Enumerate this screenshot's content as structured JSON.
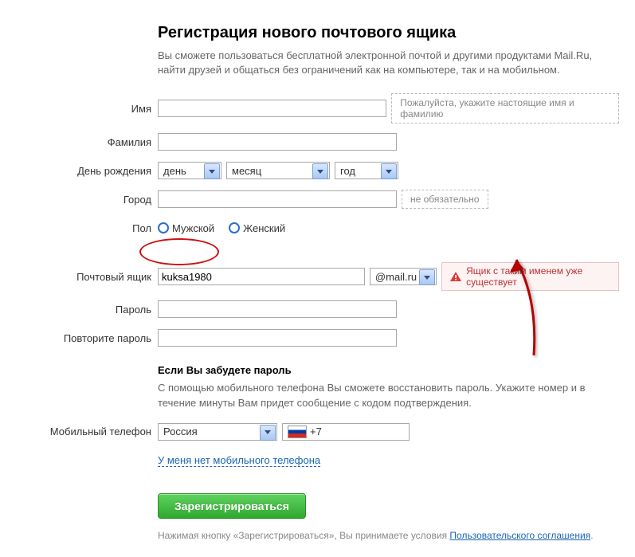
{
  "header": {
    "title": "Регистрация нового почтового ящика",
    "subtitle": "Вы сможете пользоваться бесплатной электронной почтой и другими продуктами Mail.Ru, найти друзей и общаться без ограничений как на компьютере, так и на мобильном."
  },
  "labels": {
    "first_name": "Имя",
    "last_name": "Фамилия",
    "birthday": "День рождения",
    "city": "Город",
    "gender": "Пол",
    "mailbox": "Почтовый ящик",
    "password": "Пароль",
    "password_repeat": "Повторите пароль",
    "mobile": "Мобильный телефон"
  },
  "hints": {
    "name": "Пожалуйста, укажите настоящие имя и фамилию",
    "optional": "не обязательно"
  },
  "birthday": {
    "day": "день",
    "month": "месяц",
    "year": "год"
  },
  "gender": {
    "male": "Мужской",
    "female": "Женский"
  },
  "mailbox": {
    "value": "kuksa1980",
    "domain": "@mail.ru"
  },
  "error": {
    "text": "Ящик с таким именем уже существует"
  },
  "recovery": {
    "heading": "Если Вы забудете пароль",
    "desc": "С помощью мобильного телефона Вы сможете восстановить пароль. Укажите номер и в течение минуты Вам придет сообщение с кодом подтверждения."
  },
  "phone": {
    "country": "Россия",
    "prefix": "+7"
  },
  "links": {
    "no_mobile": "У меня нет мобильного телефона",
    "agreement": "Пользовательского соглашения"
  },
  "submit": {
    "label": "Зарегистрироваться"
  },
  "terms": {
    "prefix": "Нажимая кнопку «Зарегистрироваться», Вы принимаете условия "
  }
}
